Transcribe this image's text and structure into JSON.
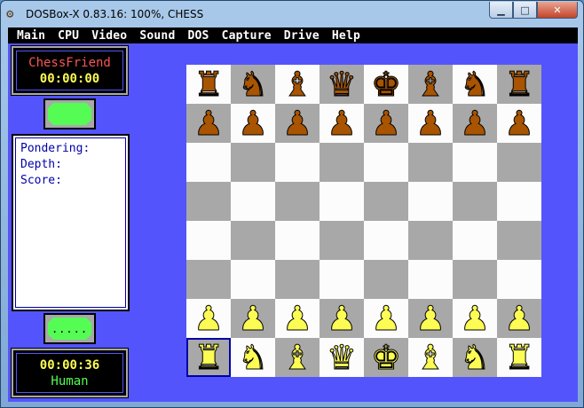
{
  "window": {
    "title": "DOSBox-X 0.83.16: 100%, CHESS",
    "icon": "dosbox-icon",
    "controls": {
      "minimize": "▁",
      "maximize": "□",
      "close": "✕"
    }
  },
  "menubar": {
    "items": [
      {
        "label": "Main"
      },
      {
        "label": "CPU"
      },
      {
        "label": "Video"
      },
      {
        "label": "Sound"
      },
      {
        "label": "DOS"
      },
      {
        "label": "Capture"
      },
      {
        "label": "Drive"
      },
      {
        "label": "Help"
      }
    ]
  },
  "opponent": {
    "name": "ChessFriend",
    "time": "00:00:00"
  },
  "opponent_indicator": {
    "text": ""
  },
  "analysis": {
    "pondering": "Pondering:",
    "depth": "Depth:",
    "score": "Score:"
  },
  "player_indicator": {
    "text": "....."
  },
  "player": {
    "time": "00:00:36",
    "name": "Human"
  },
  "board": {
    "rows": [
      [
        "♜",
        "♞",
        "♝",
        "♛",
        "♚",
        "♝",
        "♞",
        "♜"
      ],
      [
        "♟",
        "♟",
        "♟",
        "♟",
        "♟",
        "♟",
        "♟",
        "♟"
      ],
      [
        "",
        "",
        "",
        "",
        "",
        "",
        "",
        ""
      ],
      [
        "",
        "",
        "",
        "",
        "",
        "",
        "",
        ""
      ],
      [
        "",
        "",
        "",
        "",
        "",
        "",
        "",
        ""
      ],
      [
        "",
        "",
        "",
        "",
        "",
        "",
        "",
        ""
      ],
      [
        "♟",
        "♟",
        "♟",
        "♟",
        "♟",
        "♟",
        "♟",
        "♟"
      ],
      [
        "♜",
        "♞",
        "♝",
        "♛",
        "♚",
        "♝",
        "♞",
        "♜"
      ]
    ],
    "colors": {
      "light": "#fcfcfc",
      "dark": "#a8a8a8",
      "black_piece": "#a85400",
      "white_piece": "#fcfc54"
    },
    "selected": "a1"
  }
}
